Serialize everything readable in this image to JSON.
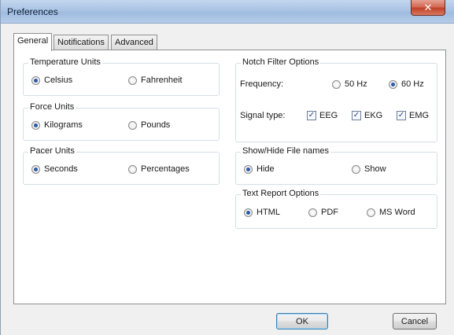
{
  "window": {
    "title": "Preferences",
    "close_glyph": "✕"
  },
  "tabs": [
    {
      "label": "General",
      "active": true
    },
    {
      "label": "Notifications",
      "active": false
    },
    {
      "label": "Advanced",
      "active": false
    }
  ],
  "groups": {
    "temperature": {
      "title": "Temperature Units",
      "options": [
        {
          "label": "Celsius",
          "checked": true
        },
        {
          "label": "Fahrenheit",
          "checked": false
        }
      ]
    },
    "force": {
      "title": "Force Units",
      "options": [
        {
          "label": "Kilograms",
          "checked": true
        },
        {
          "label": "Pounds",
          "checked": false
        }
      ]
    },
    "pacer": {
      "title": "Pacer Units",
      "options": [
        {
          "label": "Seconds",
          "checked": true
        },
        {
          "label": "Percentages",
          "checked": false
        }
      ]
    },
    "notch": {
      "title": "Notch Filter Options",
      "frequency_label": "Frequency:",
      "frequency_options": [
        {
          "label": "50 Hz",
          "checked": false
        },
        {
          "label": "60 Hz",
          "checked": true
        }
      ],
      "signal_label": "Signal type:",
      "signal_options": [
        {
          "label": "EEG",
          "checked": true
        },
        {
          "label": "EKG",
          "checked": true
        },
        {
          "label": "EMG",
          "checked": true
        }
      ]
    },
    "filenames": {
      "title": "Show/Hide File names",
      "options": [
        {
          "label": "Hide",
          "checked": true
        },
        {
          "label": "Show",
          "checked": false
        }
      ]
    },
    "report": {
      "title": "Text Report Options",
      "options": [
        {
          "label": "HTML",
          "checked": true
        },
        {
          "label": "PDF",
          "checked": false
        },
        {
          "label": "MS Word",
          "checked": false
        }
      ]
    }
  },
  "buttons": {
    "ok": "OK",
    "cancel": "Cancel"
  },
  "icons": {
    "check_glyph": "✓"
  },
  "colors": {
    "accent": "#2a5aa8",
    "close": "#c0412a"
  }
}
